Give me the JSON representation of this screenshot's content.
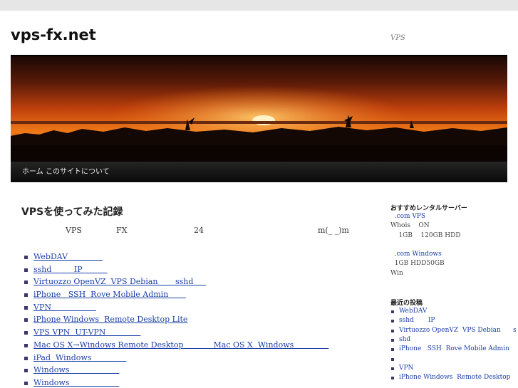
{
  "site": {
    "title": "vps-fx.net",
    "description": "VPS"
  },
  "nav": {
    "home": "ホーム",
    "about": "このサイトについて"
  },
  "main": {
    "title": "VPSを使ってみた記録",
    "intro": {
      "part1": "VPS",
      "part2": "FX",
      "part3": "24",
      "part4": "m(_ _)m"
    },
    "posts": [
      "WebDAV              ",
      "sshd         IP          ",
      "Virtuozzo OpenVZ  VPS Debian       sshd     ",
      "iPhone   SSH  Rove Mobile Admin       ",
      "VPN                  ",
      "iPhone Windows  Remote Desktop Lite",
      "VPS VPN  UT-VPN              ",
      "Mac OS X→Windows Remote Desktop            Mac OS X  Windows              ",
      "iPad  Windows              ",
      "Windows                    ",
      "Windows                    "
    ]
  },
  "sidebar": {
    "widget1": {
      "title": "おすすめレンタルサーバー",
      "lines": [
        {
          "text": "  .com VPS",
          "link": true
        },
        {
          "text": "Whois    ON",
          "link": false
        },
        {
          "text": "    1GB    120GB HDD",
          "link": false
        },
        {
          "text": "",
          "link": false
        },
        {
          "text": "  .com Windows",
          "link": true
        },
        {
          "text": "  1GB HDD50GB",
          "link": false
        },
        {
          "text": "Win",
          "link": false
        }
      ]
    },
    "widget2": {
      "title": "最近の投稿",
      "items": [
        "WebDAV",
        "sshd       IP",
        "Virtuozzo OpenVZ  VPS Debian      s",
        "shd",
        "iPhone   SSH  Rove Mobile Admin",
        "",
        "VPN",
        "iPhone Windows  Remote Desktop"
      ]
    }
  },
  "colors": {
    "link": "#1b3fa8",
    "navbar": "#0a0a0a",
    "page_bg": "#e6e6e6"
  }
}
